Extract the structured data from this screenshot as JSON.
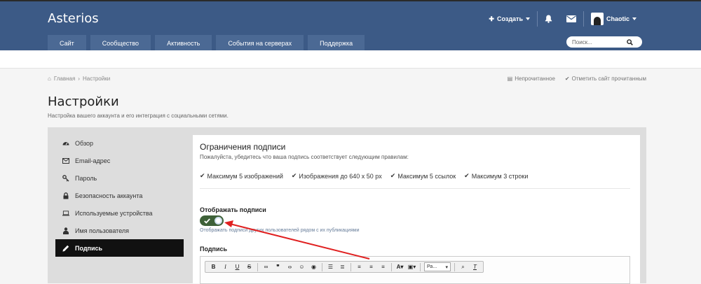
{
  "header": {
    "brand": "Asterios",
    "create_label": "Создать",
    "username": "Chaotic"
  },
  "nav": {
    "items": [
      {
        "label": "Сайт"
      },
      {
        "label": "Сообщество"
      },
      {
        "label": "Активность"
      },
      {
        "label": "События на серверах"
      },
      {
        "label": "Поддержка"
      }
    ],
    "search_placeholder": "Поиск..."
  },
  "breadcrumb": {
    "home": "Главная",
    "separator": "›",
    "current": "Настройки",
    "unread": "Непрочитанное",
    "mark_read": "Отметить сайт прочитанным"
  },
  "page": {
    "title": "Настройки",
    "description": "Настройка вашего аккаунта и его интеграция с социальными сетями."
  },
  "sidebar": {
    "items": [
      {
        "label": "Обзор",
        "icon": "dashboard-icon"
      },
      {
        "label": "Email-адрес",
        "icon": "envelope-icon"
      },
      {
        "label": "Пароль",
        "icon": "key-icon"
      },
      {
        "label": "Безопасность аккаунта",
        "icon": "lock-icon"
      },
      {
        "label": "Используемые устройства",
        "icon": "laptop-icon"
      },
      {
        "label": "Имя пользователя",
        "icon": "user-icon"
      },
      {
        "label": "Подпись",
        "icon": "pencil-icon",
        "active": true
      }
    ]
  },
  "signature": {
    "title": "Ограничения подписи",
    "description": "Пожалуйста, убедитесь что ваша подпись соответствует следующим правилам:",
    "rules": [
      "Максимум 5 изображений",
      "Изображения до 640 x 50 px",
      "Максимум 5 ссылок",
      "Максимум 3 строки"
    ],
    "show_label": "Отображать подписи",
    "show_enabled": true,
    "show_help": "Отображать подписи других пользователей рядом с их публикациями",
    "editor_label": "Подпись",
    "font_select": "Ра..."
  },
  "colors": {
    "header_bg": "#3c5a86",
    "nav_item_bg": "#4b6994",
    "toggle_on": "#3e6138",
    "annotation_arrow": "#e02020"
  }
}
